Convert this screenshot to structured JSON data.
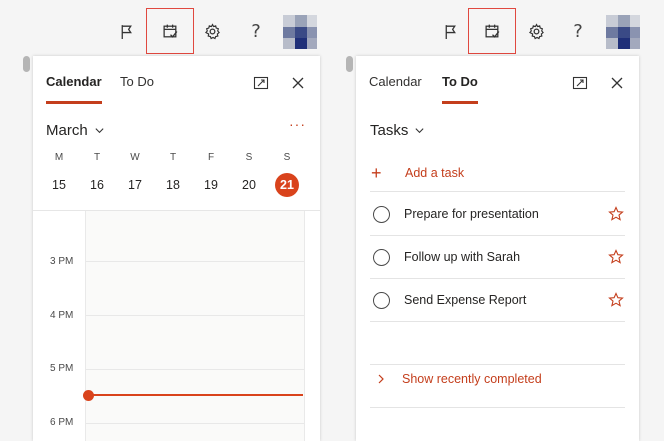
{
  "colors": {
    "accent": "#c43e1c",
    "today": "#d9431c",
    "highlight_box": "#e0483f"
  },
  "toolbar": {
    "icons": [
      "flag-icon",
      "calendar-check-icon",
      "gear-icon",
      "help-icon",
      "avatar"
    ],
    "help_glyph": "?"
  },
  "calendar_pane": {
    "tabs": [
      "Calendar",
      "To Do"
    ],
    "selected_tab": "Calendar",
    "month": "March",
    "more": "···",
    "days": [
      {
        "letter": "M",
        "num": "15"
      },
      {
        "letter": "T",
        "num": "16"
      },
      {
        "letter": "W",
        "num": "17"
      },
      {
        "letter": "T",
        "num": "18"
      },
      {
        "letter": "F",
        "num": "19"
      },
      {
        "letter": "S",
        "num": "20"
      },
      {
        "letter": "S",
        "num": "21",
        "today": true
      }
    ],
    "hours": [
      "3 PM",
      "4 PM",
      "5 PM",
      "6 PM"
    ]
  },
  "todo_pane": {
    "tabs": [
      "Calendar",
      "To Do"
    ],
    "selected_tab": "To Do",
    "list_title": "Tasks",
    "add_task": "Add a task",
    "tasks": [
      "Prepare for presentation",
      "Follow up with Sarah",
      "Send Expense Report"
    ],
    "show_completed": "Show recently completed"
  }
}
